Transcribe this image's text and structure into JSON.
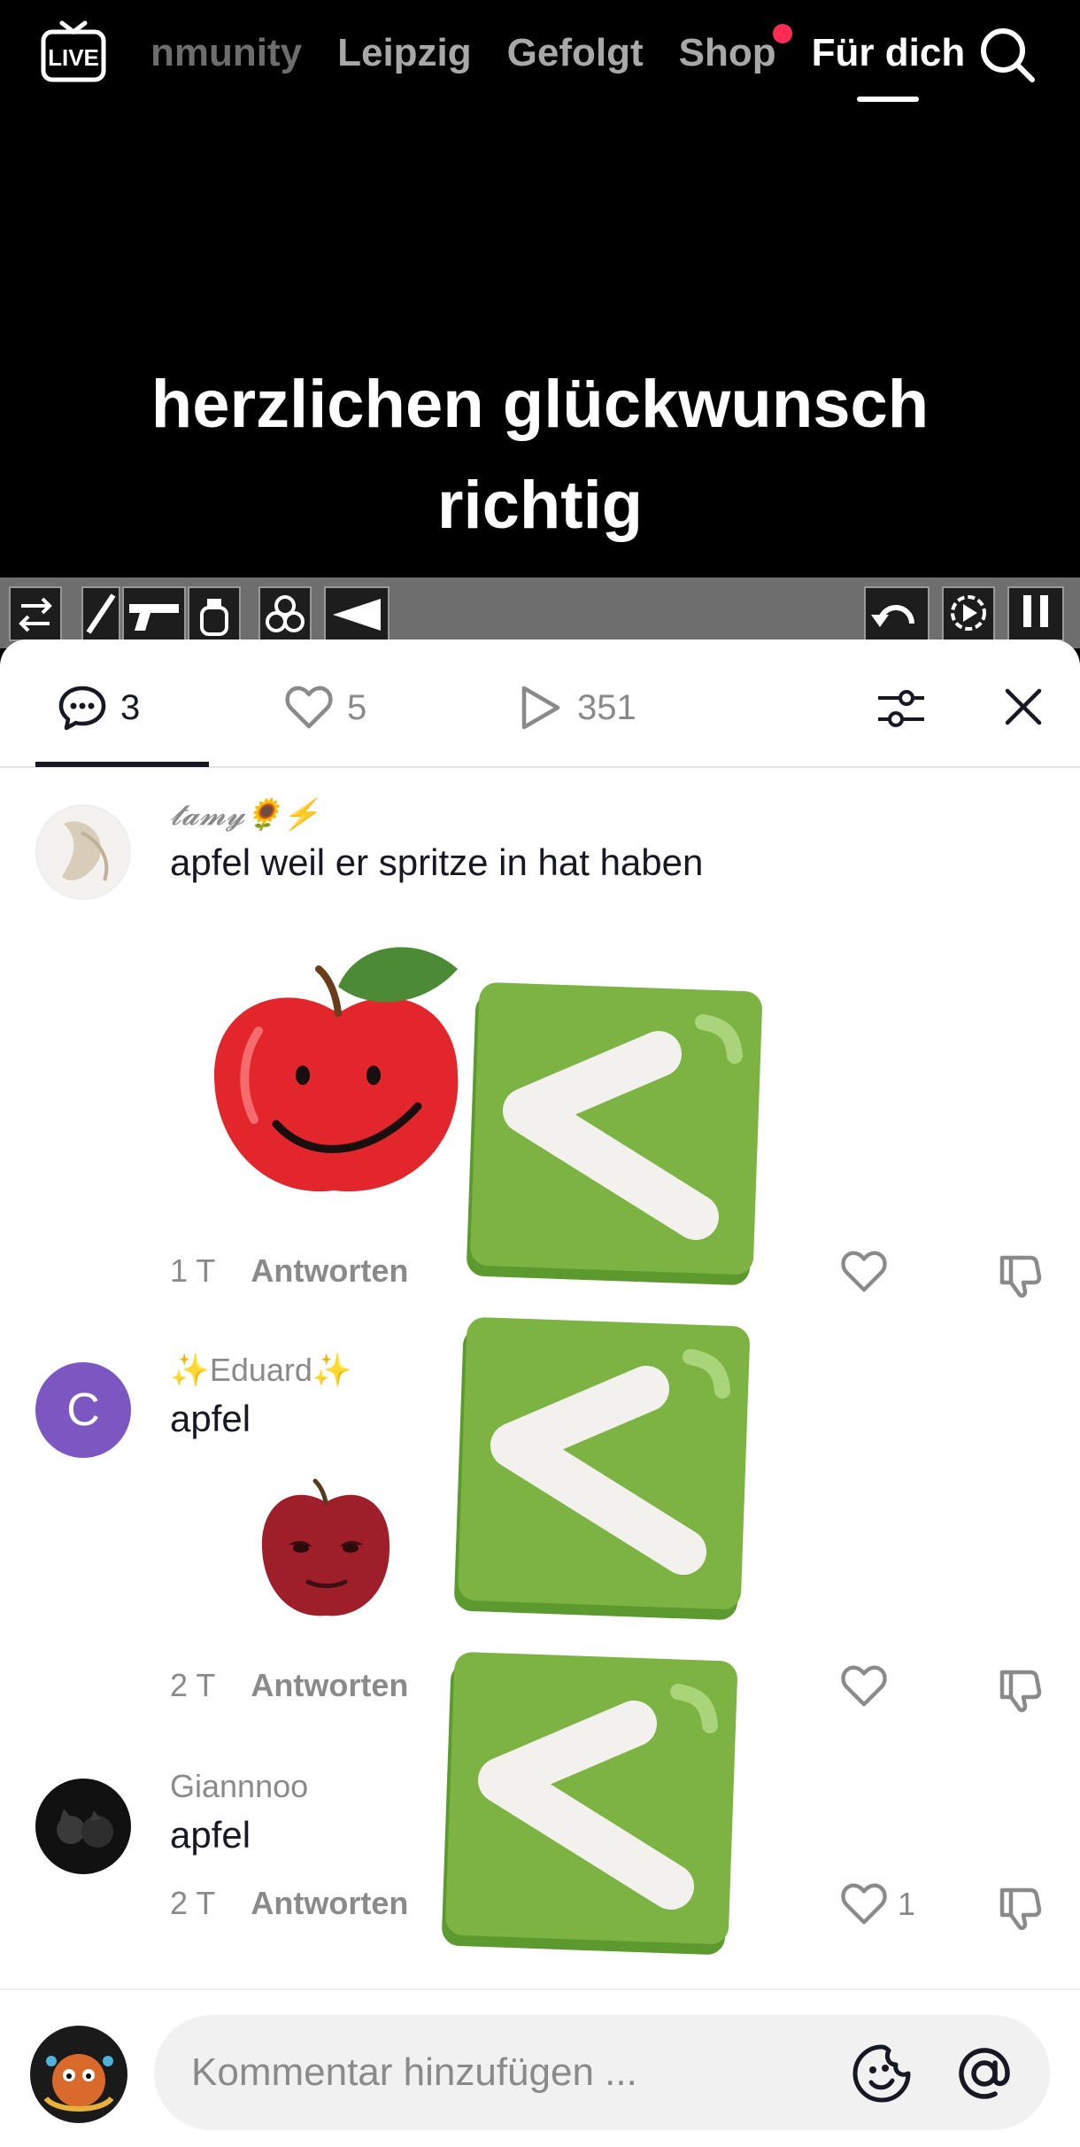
{
  "nav": {
    "tabs": [
      {
        "label": "nmunity"
      },
      {
        "label": "Leipzig"
      },
      {
        "label": "Gefolgt"
      },
      {
        "label": "Shop"
      },
      {
        "label": "Für dich"
      }
    ],
    "live_label": "LIVE"
  },
  "video": {
    "caption_line1": "herzlichen glückwunsch",
    "caption_line2": "richtig"
  },
  "stats": {
    "comments_count": "3",
    "likes_count": "5",
    "plays_count": "351"
  },
  "comments": [
    {
      "username": "𝓽𝓪𝓶𝔂🌻⚡",
      "text": "apfel weil er spritze in hat haben",
      "time": "1 T",
      "reply_label": "Antworten",
      "likes": ""
    },
    {
      "username": "✨Eduard✨",
      "avatar_letter": "C",
      "text": "apfel",
      "time": "2 T",
      "reply_label": "Antworten",
      "likes": ""
    },
    {
      "username": "Giannnoo",
      "text": "apfel",
      "time": "2 T",
      "reply_label": "Antworten",
      "likes": "1"
    }
  ],
  "composer": {
    "placeholder": "Kommentar hinzufügen ..."
  },
  "colors": {
    "accent_red": "#fe2c55",
    "sticker_green": "#7cb342",
    "avatar_purple": "#7d57c1"
  },
  "icons": [
    "live-icon",
    "search-icon",
    "comment-icon",
    "heart-icon",
    "play-icon",
    "filter-icon",
    "close-icon",
    "dislike-icon",
    "emoji-icon",
    "mention-icon"
  ]
}
